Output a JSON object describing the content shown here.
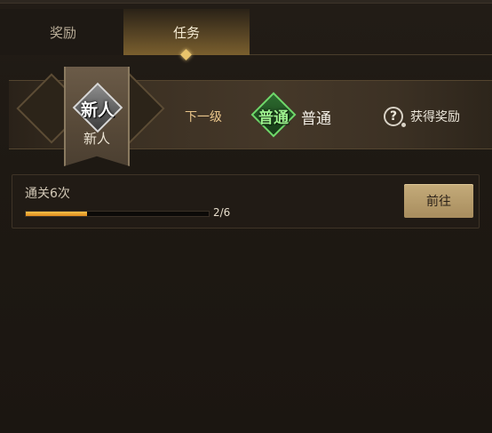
{
  "tabs": [
    {
      "label": "奖励",
      "active": false
    },
    {
      "label": "任务",
      "active": true
    }
  ],
  "rank": {
    "current_emblem": "新人",
    "current_label": "新人",
    "next_level_label": "下一级",
    "next_emblem": "普通",
    "next_name": "普通",
    "next_emblem_color": "#6ed86a"
  },
  "help": {
    "icon": "question-icon",
    "label": "获得奖励"
  },
  "tasks": [
    {
      "title": "通关6次",
      "progress_current": 2,
      "progress_total": 6,
      "progress_text": "2/6",
      "button_label": "前往"
    }
  ],
  "colors": {
    "accent_gold": "#e9c46c",
    "progress": "#f0a830",
    "button": "#b89c6a"
  }
}
